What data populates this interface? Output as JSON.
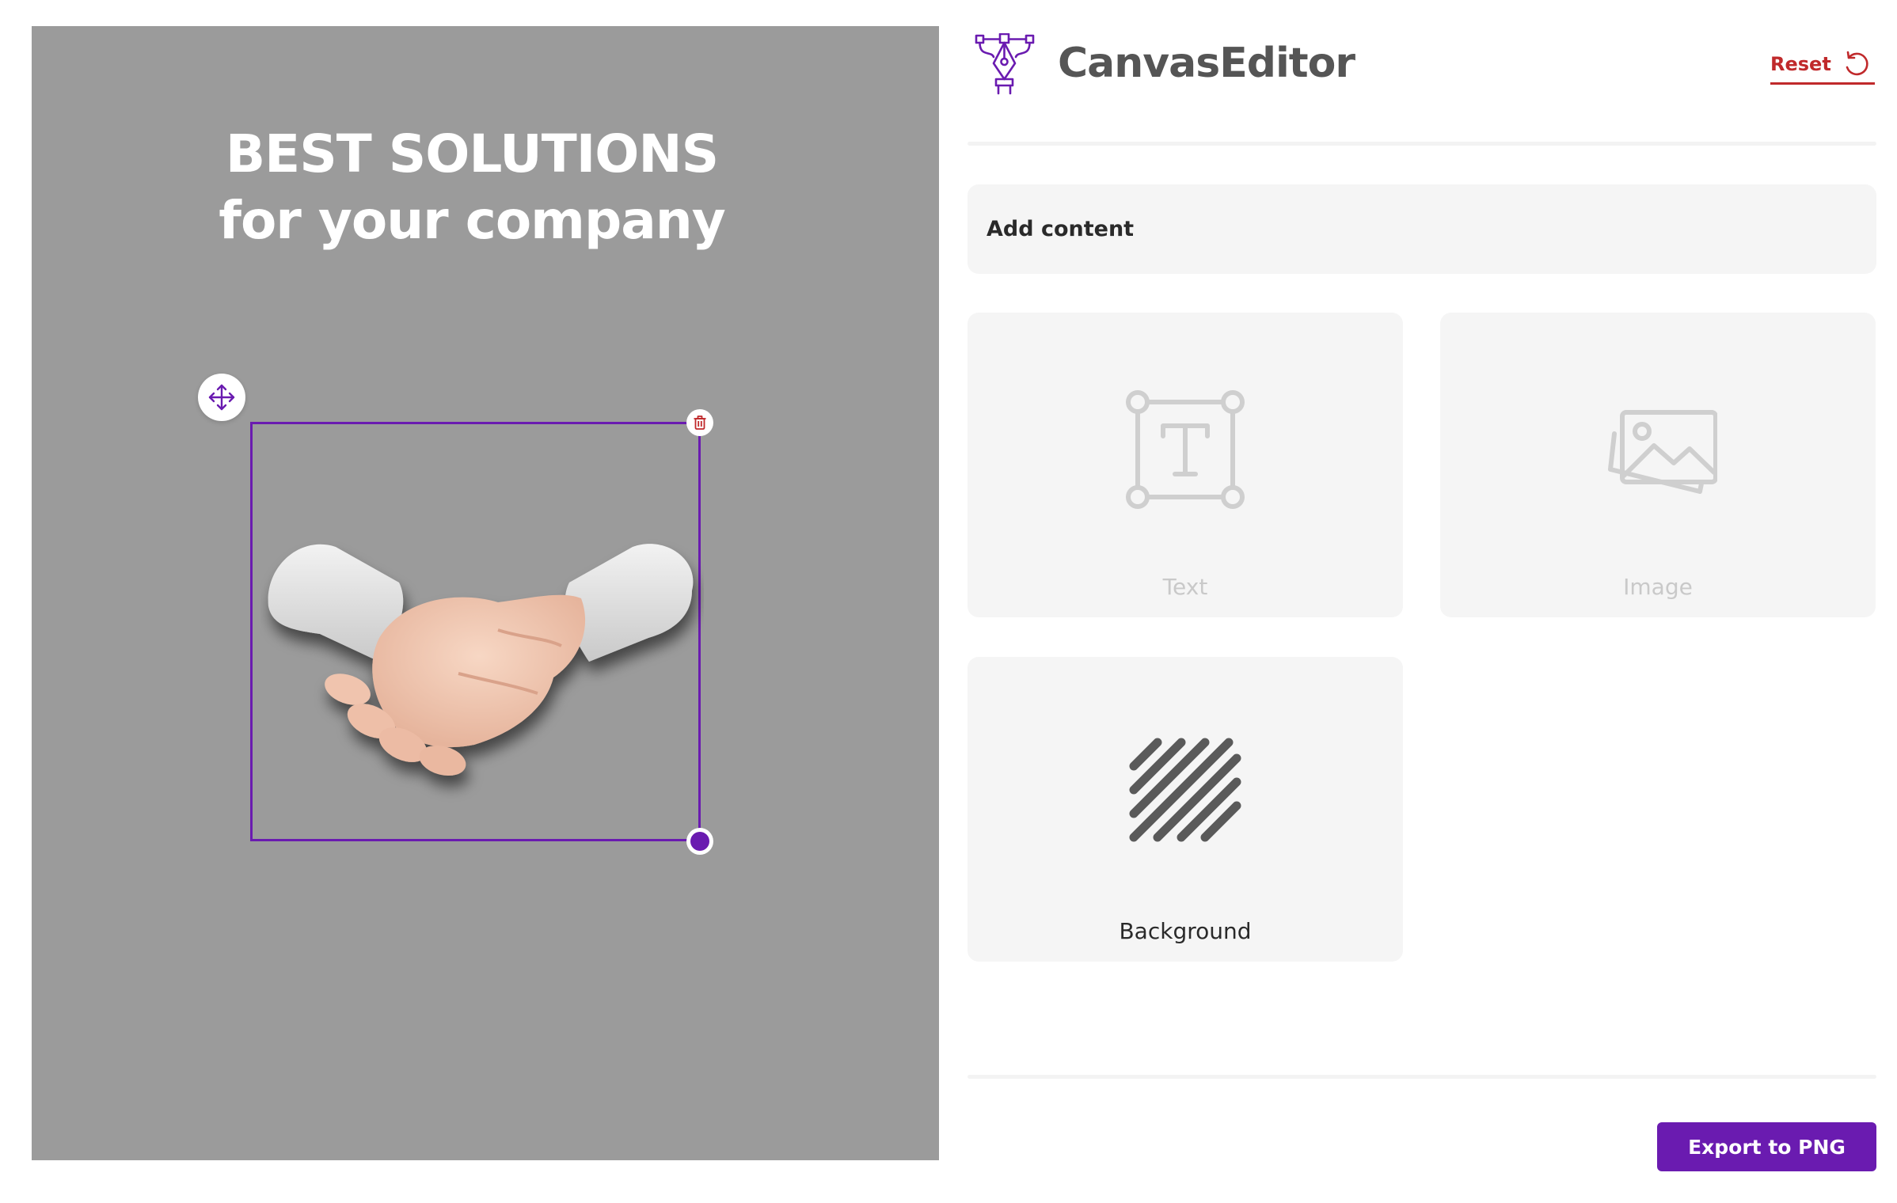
{
  "canvas": {
    "background_color": "#9b9b9b",
    "heading_line1": "BEST SOLUTIONS",
    "heading_line2": "for your company",
    "image_name": "handshake-image",
    "selection_color": "#6a1bb0"
  },
  "header": {
    "app_title": "CanvasEditor",
    "logo_icon": "pen-tool-icon",
    "reset_label": "Reset",
    "reset_icon": "undo-icon"
  },
  "add_content": {
    "title": "Add content",
    "tiles": [
      {
        "label": "Text",
        "icon": "text-box-icon",
        "enabled": false
      },
      {
        "label": "Image",
        "icon": "image-icon",
        "enabled": false
      },
      {
        "label": "Background",
        "icon": "stripes-icon",
        "enabled": true
      }
    ]
  },
  "footer": {
    "export_label": "Export to PNG"
  },
  "colors": {
    "accent": "#6a1bb0",
    "danger": "#c0292b",
    "panel": "#f5f5f5"
  }
}
